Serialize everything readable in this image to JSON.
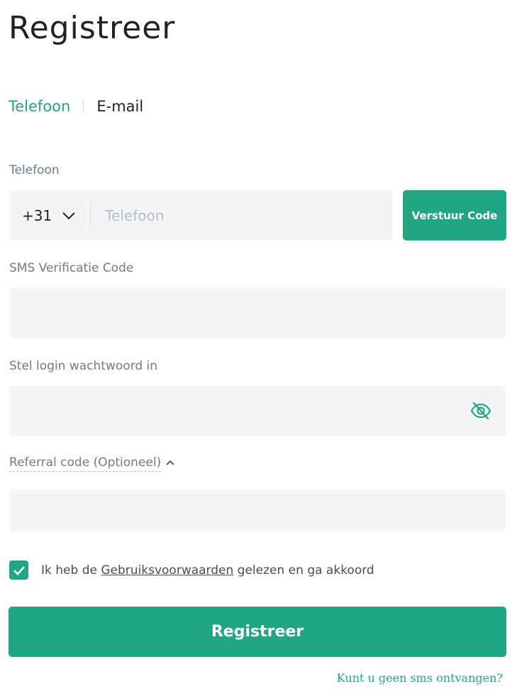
{
  "page": {
    "title": "Registreer"
  },
  "tabs": {
    "phone": "Telefoon",
    "email": "E-mail"
  },
  "phone": {
    "label": "Telefoon",
    "country_code": "+31",
    "placeholder": "Telefoon",
    "send_code_label": "Verstuur Code"
  },
  "sms": {
    "label": "SMS Verificatie Code"
  },
  "password": {
    "label": "Stel login wachtwoord in"
  },
  "referral": {
    "label": "Referral code (Optioneel)"
  },
  "terms": {
    "prefix": "Ik heb de ",
    "link": "Gebruiksvoorwaarden",
    "suffix": " gelezen en ga akkoord",
    "checked": true
  },
  "actions": {
    "register_label": "Registreer",
    "no_sms_link": "Kunt u geen sms ontvangen?"
  },
  "colors": {
    "accent": "#21a583",
    "field_bg": "#f5f5f5",
    "label": "#707a8a"
  },
  "icons": {
    "country_dropdown": "chevron-down-icon",
    "password_visibility": "eye-off-icon",
    "referral_toggle": "chevron-up-icon",
    "terms_checkbox": "checkmark-icon"
  }
}
